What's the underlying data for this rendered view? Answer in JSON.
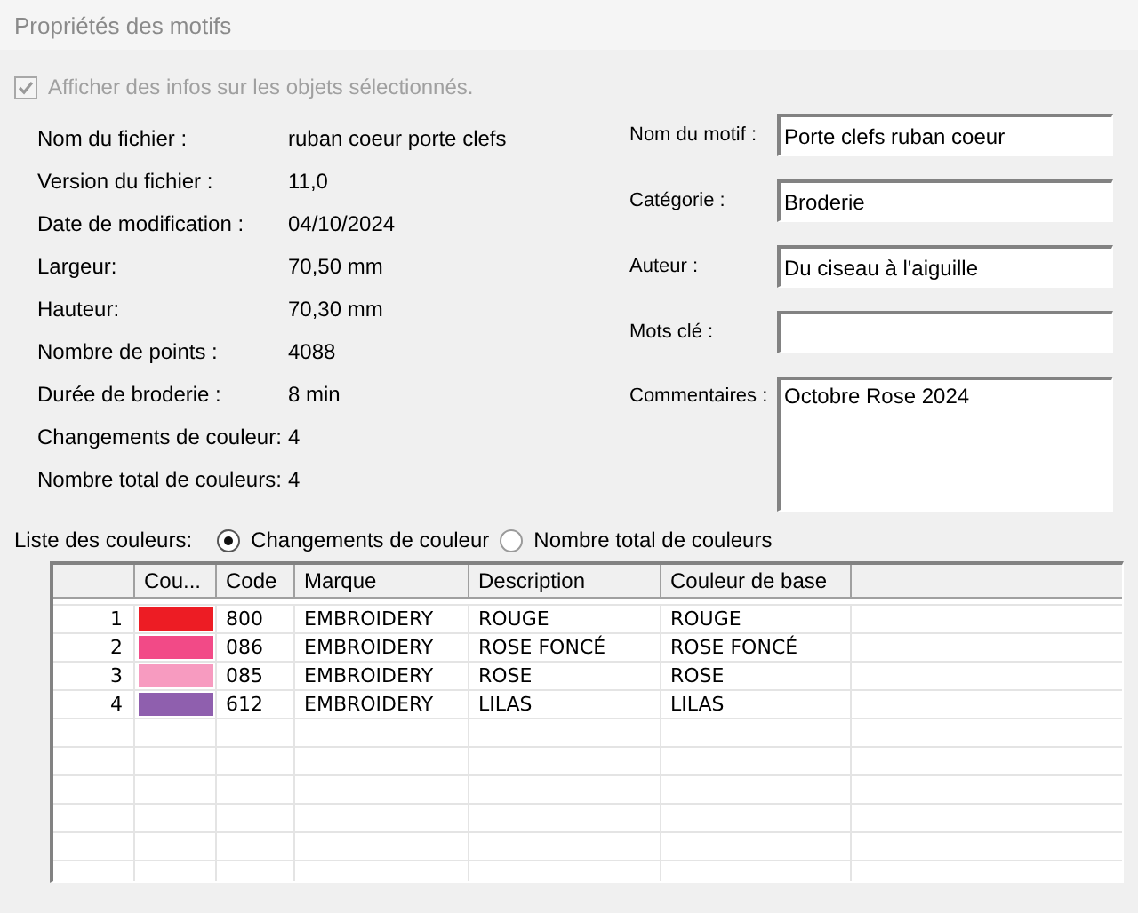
{
  "window": {
    "title": "Propriétés des motifs"
  },
  "show_selected_info": {
    "label": "Afficher des infos sur les objets sélectionnés.",
    "checked": true,
    "disabled": true
  },
  "info": [
    {
      "label": "Nom du fichier :",
      "value": "ruban coeur porte clefs"
    },
    {
      "label": "Version du fichier :",
      "value": "11,0"
    },
    {
      "label": "Date de modification :",
      "value": "04/10/2024"
    },
    {
      "label": "Largeur:",
      "value": "70,50 mm"
    },
    {
      "label": "Hauteur:",
      "value": "70,30 mm"
    },
    {
      "label": "Nombre de points :",
      "value": "4088"
    },
    {
      "label": "Durée de broderie :",
      "value": "8 min"
    },
    {
      "label": "Changements de couleur:",
      "value": "4"
    },
    {
      "label": "Nombre total de couleurs:",
      "value": "4"
    }
  ],
  "fields": [
    {
      "label": "Nom du motif :",
      "value": "Porte clefs ruban coeur",
      "kind": "line"
    },
    {
      "label": "Catégorie :",
      "value": "Broderie",
      "kind": "line"
    },
    {
      "label": "Auteur :",
      "value": "Du ciseau à l'aiguille",
      "kind": "line"
    },
    {
      "label": "Mots clé :",
      "kind": "line"
    },
    {
      "label": "Commentaires :",
      "value": "Octobre Rose 2024",
      "kind": "multiline"
    }
  ],
  "color_list": {
    "label": "Liste des couleurs:",
    "options": [
      {
        "label": "Changements de couleur",
        "selected": true
      },
      {
        "label": "Nombre total de couleurs",
        "selected": false
      }
    ]
  },
  "table": {
    "columns": [
      "Cou...",
      "Code",
      "Marque",
      "Description",
      "Couleur de base"
    ],
    "rows": [
      {
        "index": "1",
        "color": "#ed1c24",
        "code": "800",
        "brand": "EMBROIDERY",
        "description": "ROUGE",
        "base_color": "ROUGE"
      },
      {
        "index": "2",
        "color": "#f24a87",
        "code": "086",
        "brand": "EMBROIDERY",
        "description": "ROSE FONCÉ",
        "base_color": "ROSE FONCÉ"
      },
      {
        "index": "3",
        "color": "#f79bc0",
        "code": "085",
        "brand": "EMBROIDERY",
        "description": "ROSE",
        "base_color": "ROSE"
      },
      {
        "index": "4",
        "color": "#8f5fae",
        "code": "612",
        "brand": "EMBROIDERY",
        "description": "LILAS",
        "base_color": "LILAS"
      }
    ]
  }
}
